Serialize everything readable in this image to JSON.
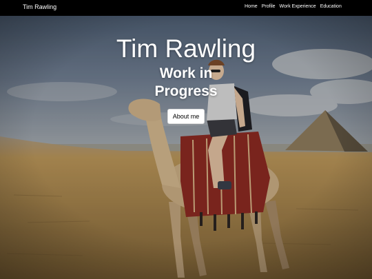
{
  "navbar": {
    "brand": "Tim Rawling",
    "links": [
      "Home",
      "Profile",
      "Work Experience",
      "Education"
    ]
  },
  "hero": {
    "title": "Tim Rawling",
    "subtitle": "Work in Progress",
    "button_label": "About me"
  },
  "colors": {
    "navbar": "#000000",
    "sky": "#6e7c8f",
    "sand": "#b89458",
    "button_bg": "#ffffff"
  }
}
